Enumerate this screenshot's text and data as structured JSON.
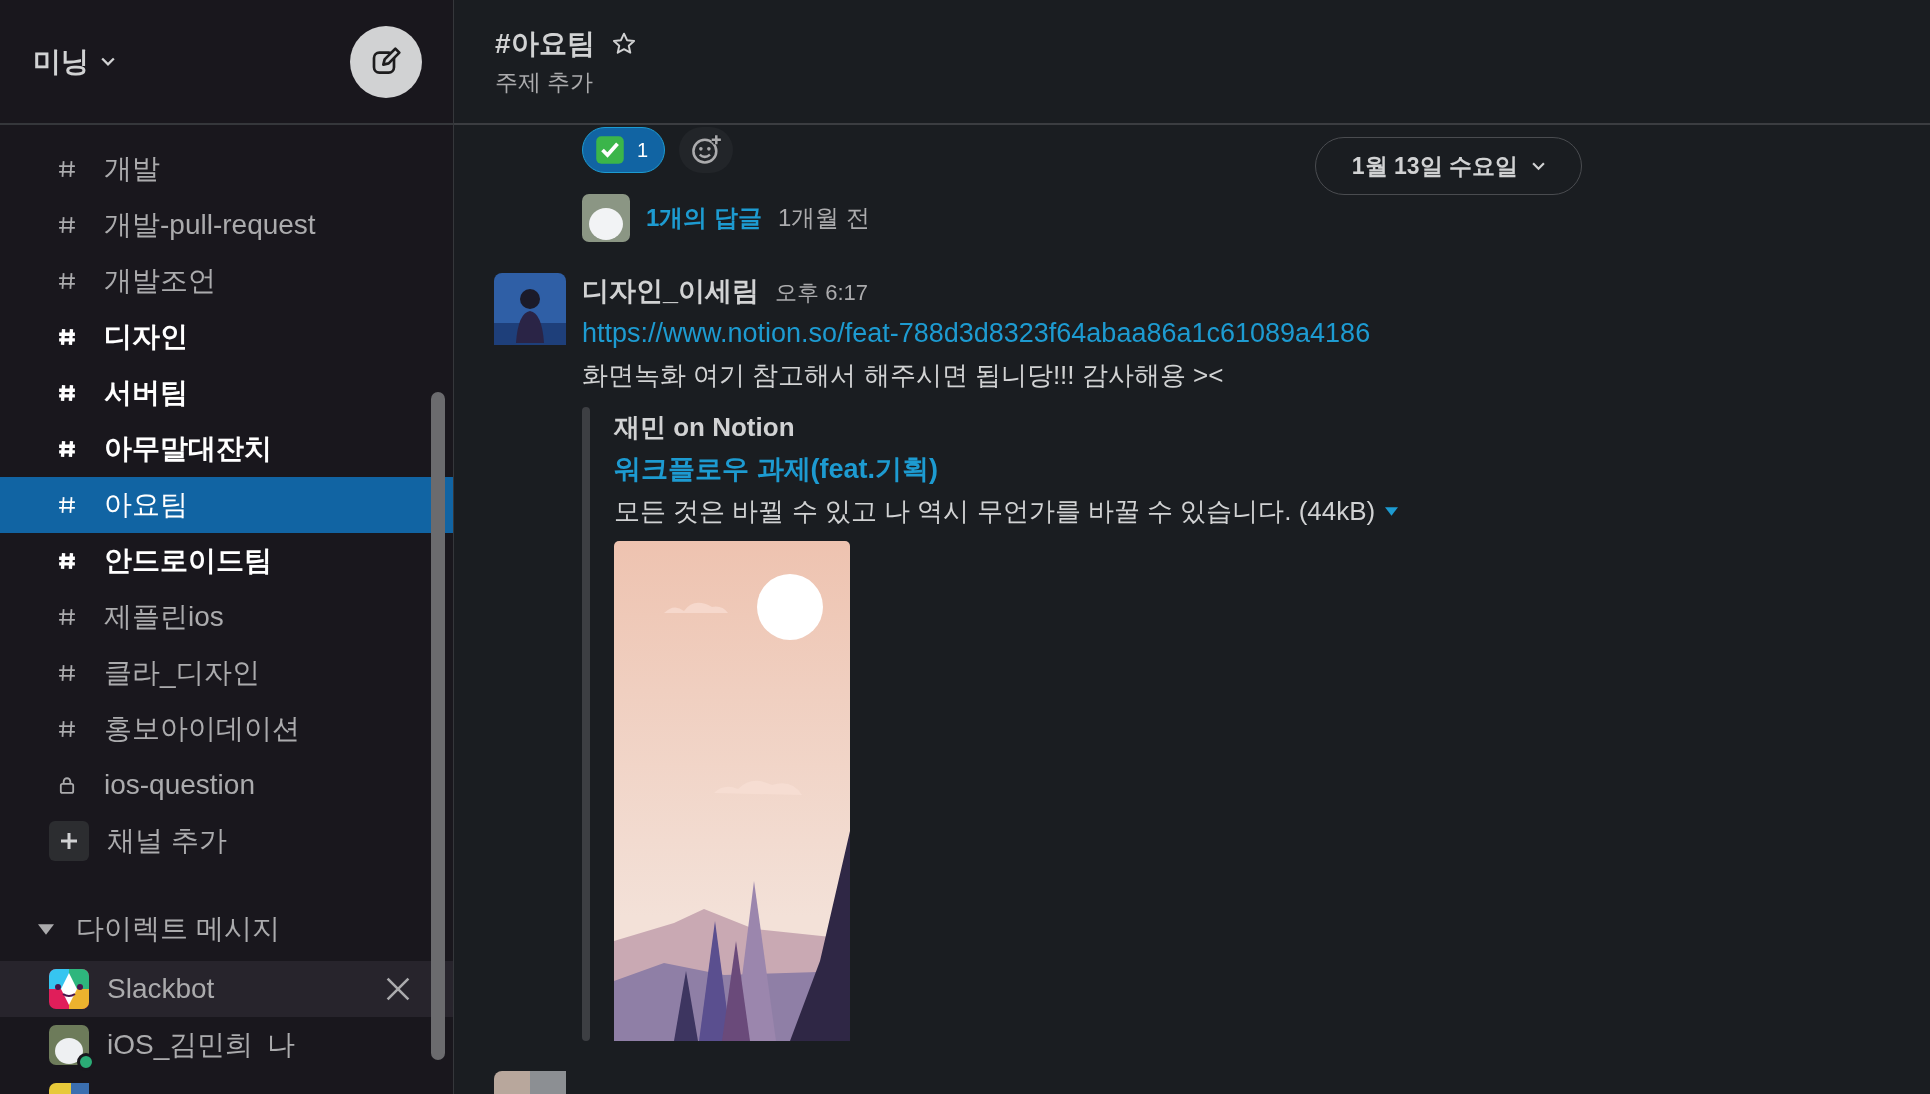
{
  "workspace": {
    "name": "미닝"
  },
  "channels": [
    {
      "name": "개발",
      "kind": "public",
      "unread": false,
      "selected": false
    },
    {
      "name": "개발-pull-request",
      "kind": "public",
      "unread": false,
      "selected": false
    },
    {
      "name": "개발조언",
      "kind": "public",
      "unread": false,
      "selected": false
    },
    {
      "name": "디자인",
      "kind": "public",
      "unread": true,
      "selected": false
    },
    {
      "name": "서버팀",
      "kind": "public",
      "unread": true,
      "selected": false
    },
    {
      "name": "아무말대잔치",
      "kind": "public",
      "unread": true,
      "selected": false
    },
    {
      "name": "아요팀",
      "kind": "public",
      "unread": false,
      "selected": true
    },
    {
      "name": "안드로이드팀",
      "kind": "public",
      "unread": true,
      "selected": false
    },
    {
      "name": "제플린ios",
      "kind": "public",
      "unread": false,
      "selected": false
    },
    {
      "name": "클라_디자인",
      "kind": "public",
      "unread": false,
      "selected": false
    },
    {
      "name": "홍보아이데이션",
      "kind": "public",
      "unread": false,
      "selected": false
    },
    {
      "name": "ios-question",
      "kind": "private",
      "unread": false,
      "selected": false
    }
  ],
  "add_channel": "채널 추가",
  "direct_messages": {
    "title": "다이렉트 메시지",
    "expanded": true,
    "items": [
      {
        "name": "Slackbot",
        "kind": "bot",
        "hovered": true,
        "online": false
      },
      {
        "name": "iOS_김민희",
        "kind": "person",
        "suffix": "나",
        "hovered": false,
        "online": true
      }
    ]
  },
  "channel_header": {
    "title": "#아요팀",
    "topic": "주제 추가"
  },
  "reaction": {
    "count": "1",
    "selected": true
  },
  "thread": {
    "replies": "1개의 답글",
    "time": "1개월 전"
  },
  "date_divider": "1월 13일 수요일",
  "message": {
    "author": "디자인_이세림",
    "time": "오후 6:17",
    "link": "https://www.notion.so/feat-788d3d8323f64abaa86a1c61089a4186",
    "text": "화면녹화 여기 참고해서 해주시면 됩니당!!! 감사해용 ><",
    "attachment": {
      "source": "재민 on Notion",
      "title": "워크플로우 과제(feat.기획)",
      "description": "모든 것은 바뀔 수 있고 나 역시 무언가를 바꿀 수 있습니다. (44kB)",
      "kind": "picture"
    }
  }
}
